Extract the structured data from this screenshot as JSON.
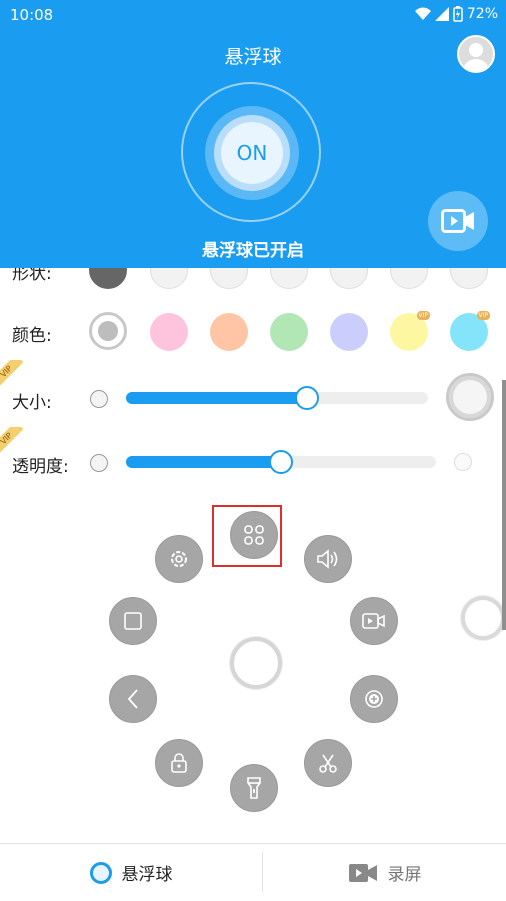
{
  "status_bar": {
    "time": "10:08",
    "battery": "72%"
  },
  "header": {
    "title": "悬浮球",
    "toggle_label": "ON",
    "status_text": "悬浮球已开启"
  },
  "rows": {
    "shape_label": "形状:",
    "color_label": "颜色:",
    "size_label": "大小:",
    "opacity_label": "透明度:",
    "vip_badge": "VIP"
  },
  "colors": [
    "#d0d0d0",
    "#ffc4dd",
    "#ffc5a4",
    "#b1e6b5",
    "#cbcdfc",
    "#fdf7a2",
    "#84e4f9"
  ],
  "sliders": {
    "size_fraction": 0.6,
    "opacity_fraction": 0.5
  },
  "menu_icons": [
    "apps-icon",
    "settings-icon",
    "volume-icon",
    "square-icon",
    "screen-record-icon",
    "back-icon",
    "add-icon",
    "lock-icon",
    "scissors-icon",
    "flashlight-icon"
  ],
  "bottom_nav": {
    "tab1": "悬浮球",
    "tab2": "录屏"
  },
  "theme": {
    "accent": "#1a9cf0"
  }
}
